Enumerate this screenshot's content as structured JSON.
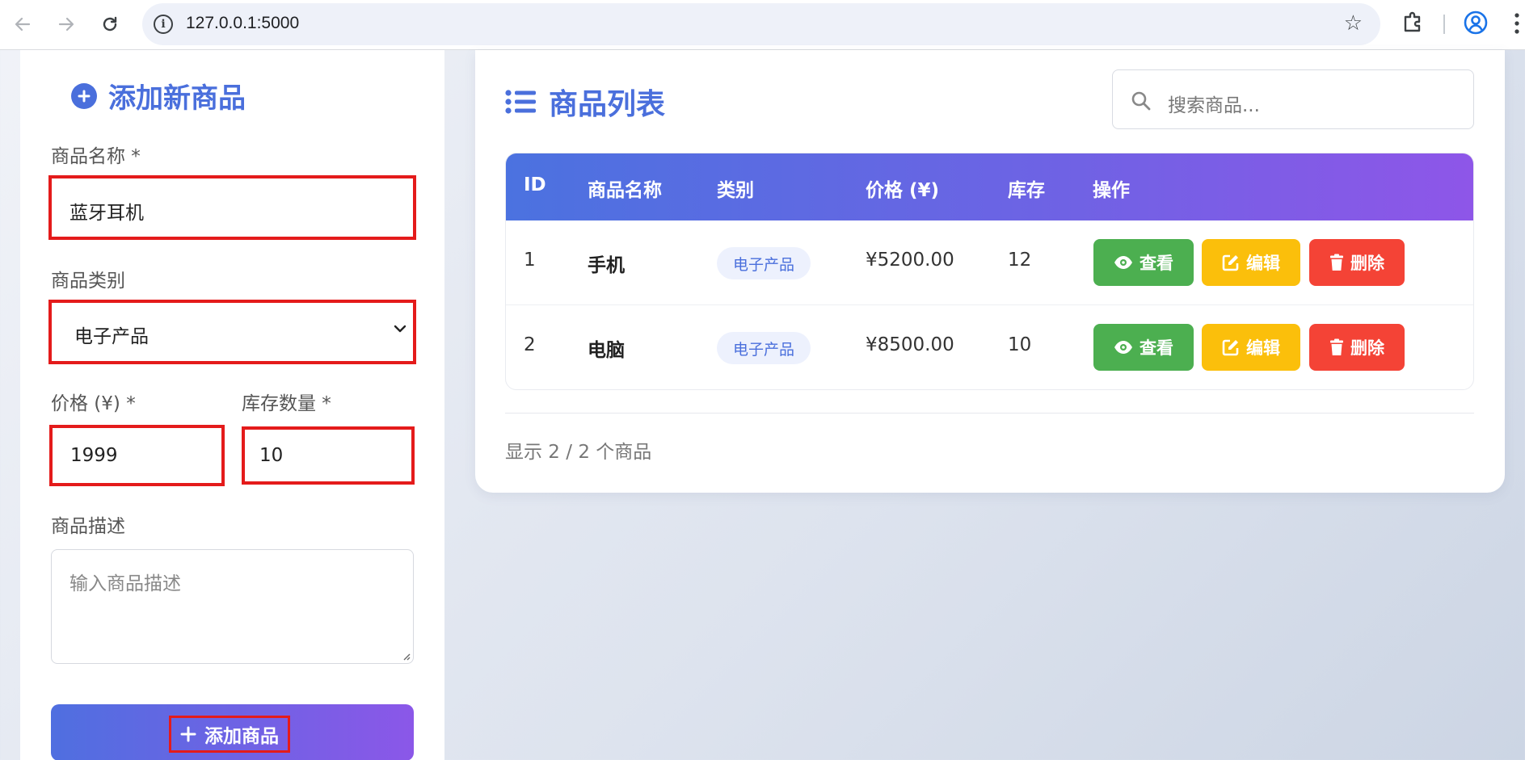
{
  "browser": {
    "url": "127.0.0.1:5000"
  },
  "form": {
    "title": "添加新商品",
    "name_label": "商品名称 *",
    "name_value": "蓝牙耳机",
    "category_label": "商品类别",
    "category_value": "电子产品",
    "price_label": "价格 (¥) *",
    "price_value": "1999",
    "stock_label": "库存数量 *",
    "stock_value": "10",
    "desc_label": "商品描述",
    "desc_placeholder": "输入商品描述",
    "submit_label": "添加商品"
  },
  "list": {
    "title": "商品列表",
    "search_placeholder": "搜索商品...",
    "columns": [
      "ID",
      "商品名称",
      "类别",
      "价格 (¥)",
      "库存",
      "操作"
    ],
    "rows": [
      {
        "id": "1",
        "name": "手机",
        "category": "电子产品",
        "price": "¥5200.00",
        "stock": "12",
        "view": "查看",
        "edit": "编辑",
        "delete": "删除"
      },
      {
        "id": "2",
        "name": "电脑",
        "category": "电子产品",
        "price": "¥8500.00",
        "stock": "10",
        "view": "查看",
        "edit": "编辑",
        "delete": "删除"
      }
    ],
    "footer": "显示 2 / 2 个商品"
  },
  "colors": {
    "accent": "#4a6fdc",
    "view_button": "#4caf50",
    "edit_button": "#fbbf0b",
    "delete_button": "#f44336",
    "highlight_outline": "#e41b1b"
  },
  "icons": {
    "back": "arrow-left-icon",
    "forward": "arrow-right-icon",
    "reload": "reload-icon",
    "info": "info-icon",
    "bookmark": "star-icon",
    "extensions": "puzzle-icon",
    "profile": "profile-icon",
    "menu": "kebab-menu-icon",
    "form_title": "plus-circle-icon",
    "list_title": "list-icon",
    "search": "search-icon",
    "view": "eye-icon",
    "edit": "edit-icon",
    "delete": "trash-icon",
    "submit": "plus-icon"
  }
}
